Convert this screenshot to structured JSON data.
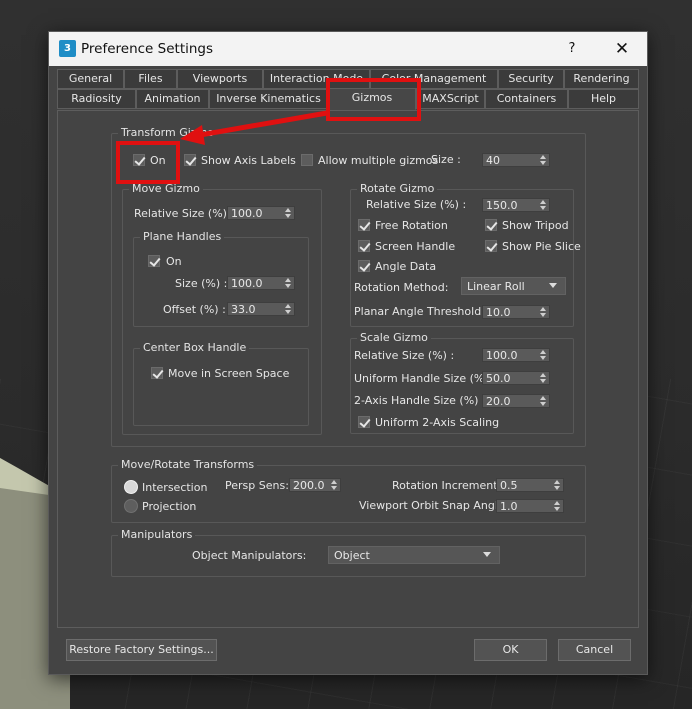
{
  "window": {
    "title": "Preference Settings",
    "help_label": "?",
    "close_label": "✕",
    "app_icon_label": "3"
  },
  "tabs": {
    "row1": [
      "General",
      "Files",
      "Viewports",
      "Interaction Mode",
      "Color Management",
      "Security",
      "Rendering"
    ],
    "row2": [
      "Radiosity",
      "Animation",
      "Inverse Kinematics",
      "Gizmos",
      "MAXScript",
      "Containers",
      "Help"
    ],
    "active": "Gizmos"
  },
  "transform_gizmo": {
    "title": "Transform Gizmo",
    "on": {
      "label": "On",
      "checked": true
    },
    "show_axis_labels": {
      "label": "Show Axis Labels",
      "checked": true
    },
    "allow_multiple": {
      "label": "Allow multiple gizmos",
      "checked": false
    },
    "size_label": "Size :",
    "size_value": "40"
  },
  "move_gizmo": {
    "title": "Move Gizmo",
    "relative_size_label": "Relative Size (%) :",
    "relative_size_value": "100.0",
    "plane_handles": {
      "title": "Plane Handles",
      "on_label": "On",
      "size_label": "Size (%) :",
      "size_value": "100.0",
      "offset_label": "Offset (%) :",
      "offset_value": "33.0"
    },
    "center_box": {
      "title": "Center Box Handle",
      "move_label": "Move in Screen Space"
    }
  },
  "rotate_gizmo": {
    "title": "Rotate Gizmo",
    "relative_size_label": "Relative Size (%) :",
    "relative_size_value": "150.0",
    "free_rotation_label": "Free Rotation",
    "show_tripod_label": "Show Tripod",
    "screen_handle_label": "Screen Handle",
    "show_pie_slice_label": "Show Pie Slice",
    "angle_data_label": "Angle Data",
    "rotation_method_label": "Rotation Method:",
    "rotation_method_value": "Linear Roll",
    "planar_angle_label": "Planar Angle Threshold :",
    "planar_angle_value": "10.0"
  },
  "scale_gizmo": {
    "title": "Scale Gizmo",
    "relative_size_label": "Relative Size (%) :",
    "relative_size_value": "100.0",
    "uniform_handle_label": "Uniform Handle Size (%) :",
    "uniform_handle_value": "50.0",
    "two_axis_label": "2-Axis Handle Size (%) :",
    "two_axis_value": "20.0",
    "uniform_scaling_label": "Uniform 2-Axis Scaling"
  },
  "move_rotate": {
    "title": "Move/Rotate Transforms",
    "intersection_label": "Intersection",
    "projection_label": "Projection",
    "persp_sens_label": "Persp Sens:",
    "persp_sens_value": "200.0",
    "rotation_increment_label": "Rotation Increment:",
    "rotation_increment_value": "0.5",
    "orbit_snap_label": "Viewport Orbit Snap Angle:",
    "orbit_snap_value": "1.0"
  },
  "manipulators": {
    "title": "Manipulators",
    "object_label": "Object Manipulators:",
    "object_value": "Object"
  },
  "footer": {
    "restore_label": "Restore Factory Settings...",
    "ok_label": "OK",
    "cancel_label": "Cancel"
  },
  "colors": {
    "annotation": "#e01010",
    "dialog_bg": "#444444",
    "titlebar_bg": "#f3f3f3"
  }
}
